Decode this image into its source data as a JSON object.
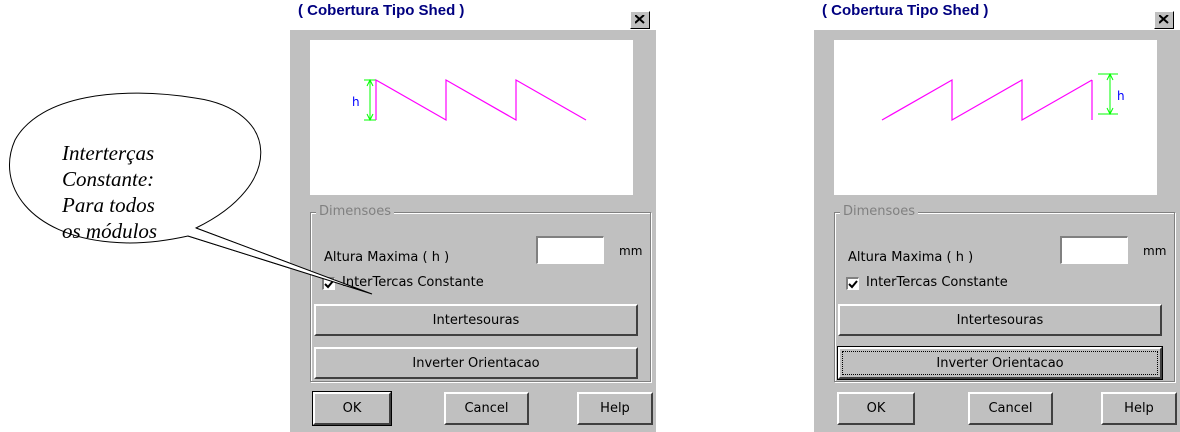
{
  "callout": {
    "lines": [
      "Interterças",
      "Constante:",
      "Para todos",
      "os módulos"
    ]
  },
  "dialogs": [
    {
      "title": "( Cobertura Tipo Shed )",
      "group_label": "Dimensoes",
      "height_label": "Altura Maxima ( h )",
      "height_value": "",
      "unit": "mm",
      "checkbox_label": "InterTercas Constante",
      "checkbox_checked": true,
      "intertesouras_label": "Intertesouras",
      "inverter_label": "Inverter Orientacao",
      "ok_label": "OK",
      "cancel_label": "Cancel",
      "help_label": "Help",
      "diagram_h_label": "h",
      "orientation": "left"
    },
    {
      "title": "( Cobertura Tipo Shed )",
      "group_label": "Dimensoes",
      "height_label": "Altura Maxima ( h )",
      "height_value": "",
      "unit": "mm",
      "checkbox_label": "InterTercas Constante",
      "checkbox_checked": true,
      "intertesouras_label": "Intertesouras",
      "inverter_label": "Inverter Orientacao",
      "ok_label": "OK",
      "cancel_label": "Cancel",
      "help_label": "Help",
      "diagram_h_label": "h",
      "orientation": "right"
    }
  ],
  "colors": {
    "roof_line": "#ff00ff",
    "dimension_line": "#00ff00",
    "dimension_label": "#0000ff",
    "title_text": "#000080"
  }
}
